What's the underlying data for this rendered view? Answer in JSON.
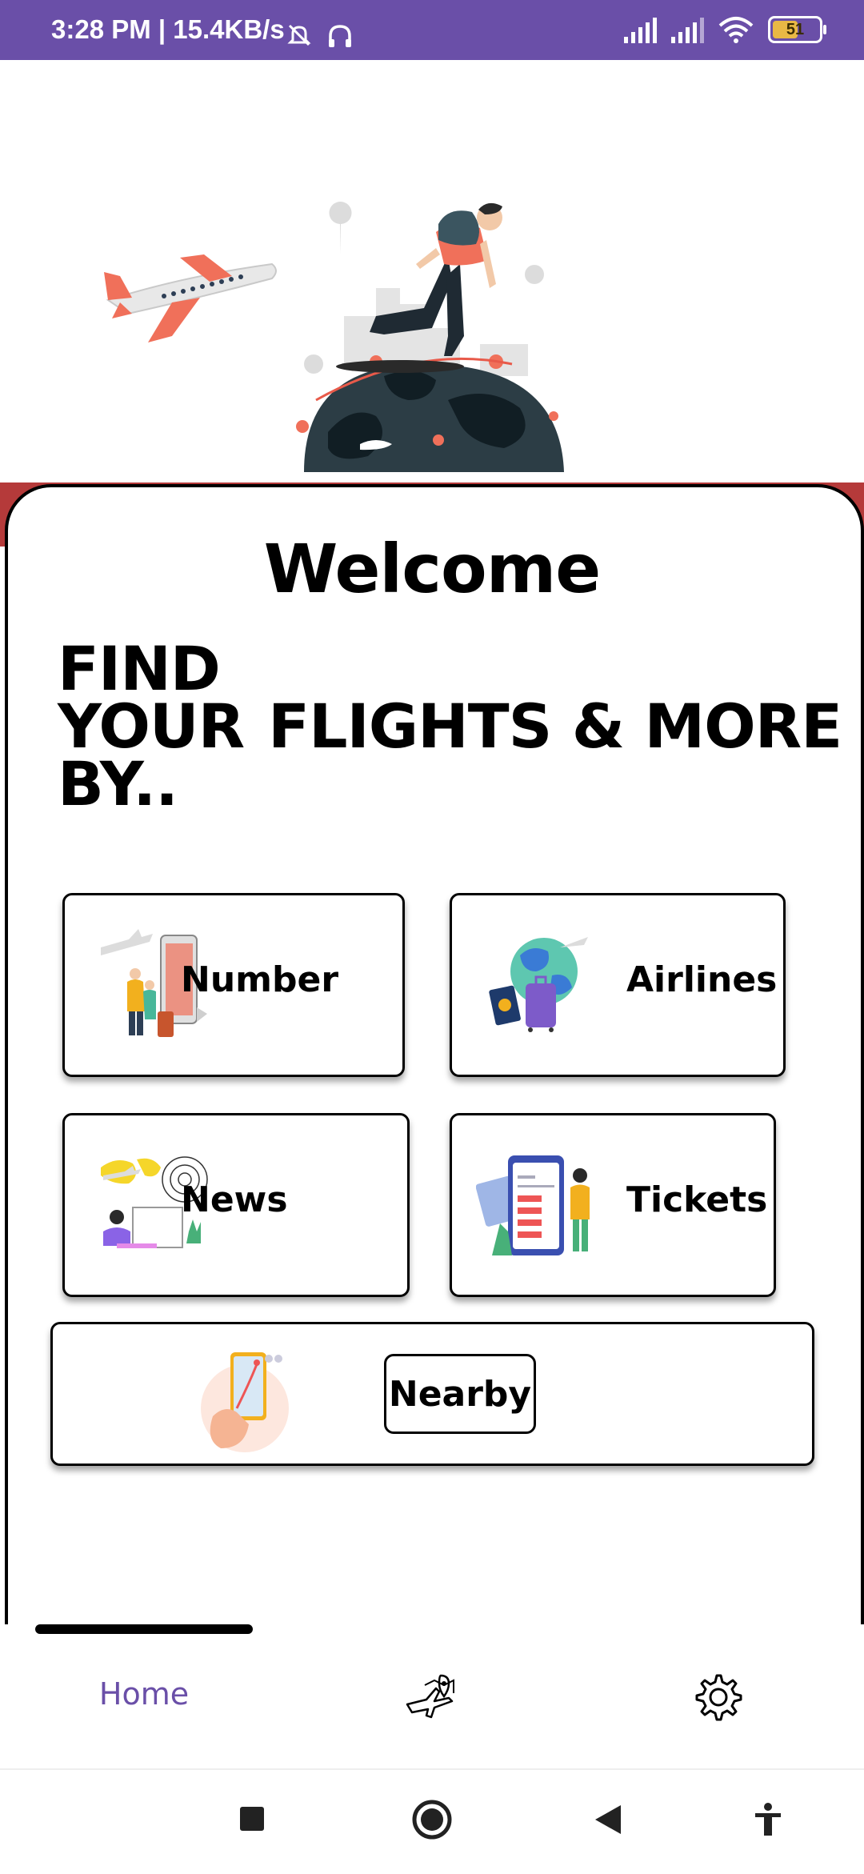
{
  "status_bar": {
    "time": "3:28 PM | 15.4KB/s",
    "battery": "51",
    "icons": [
      "mute-icon",
      "headphones-icon",
      "signal-icon",
      "signal-icon",
      "wifi-icon",
      "battery-icon"
    ]
  },
  "welcome": "Welcome",
  "headline": {
    "line1": "FIND",
    "line2a": "YOUR",
    "line2b": "FLIGHTS & MORE",
    "line3": "BY.."
  },
  "options": {
    "number": "Number",
    "airlines": "Airlines",
    "news": "News",
    "tickets": "Tickets",
    "nearby": "Nearby"
  },
  "bottom_nav": {
    "home": "Home",
    "icons": [
      "flight-map-icon",
      "settings-gear-icon"
    ]
  },
  "system_nav": [
    "recents-square-icon",
    "home-circle-icon",
    "back-triangle-icon",
    "accessibility-icon"
  ],
  "colors": {
    "status_bar": "#6a4fa8",
    "accent": "#6a4fa8",
    "red_strip": "#b53a3a",
    "plane_orange": "#f0705a"
  }
}
